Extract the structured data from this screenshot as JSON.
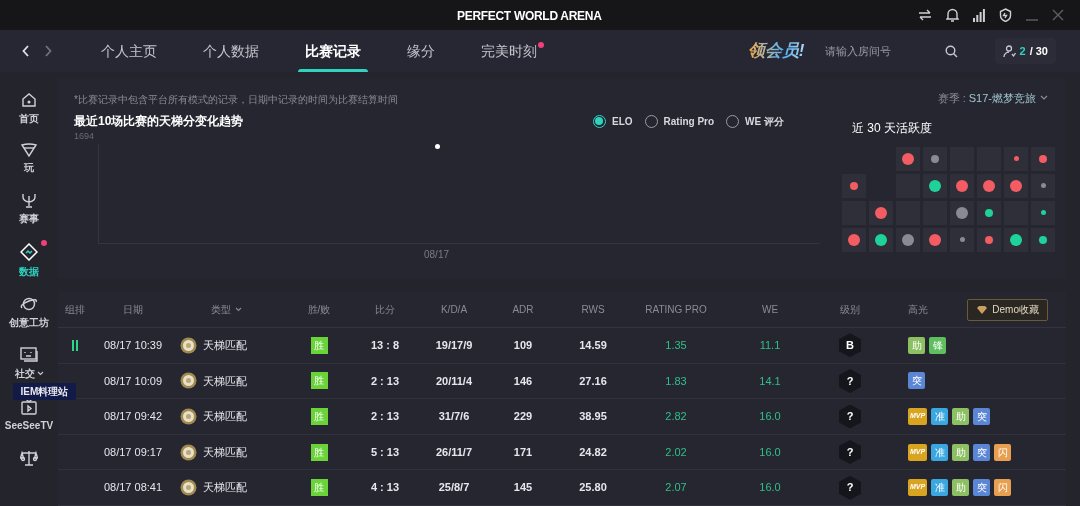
{
  "window": {
    "title": "PERFECT WORLD ARENA"
  },
  "nav_tabs": [
    {
      "label": "个人主页",
      "selected": false,
      "badge": false
    },
    {
      "label": "个人数据",
      "selected": false,
      "badge": false
    },
    {
      "label": "比赛记录",
      "selected": true,
      "badge": false
    },
    {
      "label": "缘分",
      "selected": false,
      "badge": false
    },
    {
      "label": "完美时刻",
      "selected": false,
      "badge": true
    }
  ],
  "promo": "领会员!",
  "search": {
    "placeholder": "请输入房间号"
  },
  "party_count": {
    "current": "2",
    "total": "/ 30"
  },
  "sidebar": {
    "items": [
      {
        "kind": "home",
        "label": "首页",
        "selected": false,
        "badge": false
      },
      {
        "kind": "play",
        "label": "玩",
        "selected": false,
        "badge": false
      },
      {
        "kind": "trophy",
        "label": "赛事",
        "selected": false,
        "badge": false
      },
      {
        "kind": "data",
        "label": "数据",
        "selected": true,
        "badge": true
      },
      {
        "kind": "planet",
        "label": "创意工坊",
        "selected": false,
        "badge": false
      },
      {
        "kind": "social",
        "label": "社交",
        "selected": false,
        "badge": false
      },
      {
        "kind": "tv",
        "label": "SeeSeeTV",
        "selected": false,
        "badge": false
      },
      {
        "kind": "scale",
        "selected": false,
        "badge": false
      }
    ],
    "tag": "IEM料理站"
  },
  "note": "*比赛记录中包含平台所有模式的记录，日期中记录的时间为比赛结算时间",
  "chart": {
    "title": "最近10场比赛的天梯分变化趋势",
    "y_label": "1694",
    "x_label": "08/17"
  },
  "metrics": [
    {
      "label": "ELO",
      "selected": true
    },
    {
      "label": "Rating Pro",
      "selected": false
    },
    {
      "label": "WE 评分",
      "selected": false
    }
  ],
  "season": {
    "label": "赛季 : ",
    "value": "S17-燃梦竞旅"
  },
  "activity": {
    "title": "近 30 天活跃度",
    "cells": [
      {
        "kind": "blank"
      },
      {
        "kind": "blank"
      },
      {
        "kind": "large",
        "color": "#f25c62"
      },
      {
        "kind": "small",
        "color": "#8a8a92"
      },
      {
        "kind": "empty"
      },
      {
        "kind": "empty"
      },
      {
        "kind": "tiny",
        "color": "#f25c62"
      },
      {
        "kind": "small",
        "color": "#f25c62"
      },
      {
        "kind": "small",
        "color": "#f25c62"
      },
      {
        "kind": "blank"
      },
      {
        "kind": "empty"
      },
      {
        "kind": "large",
        "color": "#1ed39a"
      },
      {
        "kind": "large",
        "color": "#f25c62"
      },
      {
        "kind": "large",
        "color": "#f25c62"
      },
      {
        "kind": "large",
        "color": "#f25c62"
      },
      {
        "kind": "tiny",
        "color": "#8a8a92"
      },
      {
        "kind": "empty"
      },
      {
        "kind": "large",
        "color": "#f25c62"
      },
      {
        "kind": "empty"
      },
      {
        "kind": "empty"
      },
      {
        "kind": "large",
        "color": "#8a8a92"
      },
      {
        "kind": "small",
        "color": "#1ed39a"
      },
      {
        "kind": "empty"
      },
      {
        "kind": "tiny",
        "color": "#1ed39a"
      },
      {
        "kind": "large",
        "color": "#f25c62"
      },
      {
        "kind": "large",
        "color": "#1ed39a"
      },
      {
        "kind": "large",
        "color": "#8a8a92"
      },
      {
        "kind": "large",
        "color": "#f25c62"
      },
      {
        "kind": "tiny",
        "color": "#8a8a92"
      },
      {
        "kind": "small",
        "color": "#f25c62"
      },
      {
        "kind": "large",
        "color": "#1ed39a"
      },
      {
        "kind": "small",
        "color": "#1ed39a"
      }
    ]
  },
  "table": {
    "columns": [
      "组排",
      "日期",
      "类型",
      "胜/败",
      "比分",
      "K/D/A",
      "ADR",
      "RWS",
      "RATING PRO",
      "WE",
      "级别",
      "高光"
    ],
    "demo_button": "Demo收藏",
    "rows": [
      {
        "party": true,
        "date": "08/17 10:39",
        "type": "天梯匹配",
        "result": "胜",
        "score": "13 : 8",
        "kda": "19/17/9",
        "adr": "109",
        "rws": "14.59",
        "rating": "1.35",
        "we": "11.1",
        "rank": "B",
        "highlights": [
          {
            "label": "助",
            "color": "#8cc063"
          },
          {
            "label": "锋",
            "color": "#5fbf5f"
          }
        ]
      },
      {
        "party": false,
        "date": "08/17 10:09",
        "type": "天梯匹配",
        "result": "胜",
        "score": "2 : 13",
        "kda": "20/11/4",
        "adr": "146",
        "rws": "27.16",
        "rating": "1.83",
        "we": "14.1",
        "rank": "?",
        "highlights": [
          {
            "label": "突",
            "color": "#5b86d6"
          }
        ]
      },
      {
        "party": false,
        "date": "08/17 09:42",
        "type": "天梯匹配",
        "result": "胜",
        "score": "2 : 13",
        "kda": "31/7/6",
        "adr": "229",
        "rws": "38.95",
        "rating": "2.82",
        "we": "16.0",
        "rank": "?",
        "highlights": [
          {
            "label": "MVP",
            "color": "#d9a520"
          },
          {
            "label": "准",
            "color": "#3aa7e0"
          },
          {
            "label": "助",
            "color": "#8cc063"
          },
          {
            "label": "突",
            "color": "#5b86d6"
          }
        ]
      },
      {
        "party": false,
        "date": "08/17 09:17",
        "type": "天梯匹配",
        "result": "胜",
        "score": "5 : 13",
        "kda": "26/11/7",
        "adr": "171",
        "rws": "24.82",
        "rating": "2.02",
        "we": "16.0",
        "rank": "?",
        "highlights": [
          {
            "label": "MVP",
            "color": "#d9a520"
          },
          {
            "label": "准",
            "color": "#3aa7e0"
          },
          {
            "label": "助",
            "color": "#8cc063"
          },
          {
            "label": "突",
            "color": "#5b86d6"
          },
          {
            "label": "闪",
            "color": "#e8a050"
          }
        ]
      },
      {
        "party": false,
        "date": "08/17 08:41",
        "type": "天梯匹配",
        "result": "胜",
        "score": "4 : 13",
        "kda": "25/8/7",
        "adr": "145",
        "rws": "25.80",
        "rating": "2.07",
        "we": "16.0",
        "rank": "?",
        "highlights": [
          {
            "label": "MVP",
            "color": "#d9a520"
          },
          {
            "label": "准",
            "color": "#3aa7e0"
          },
          {
            "label": "助",
            "color": "#8cc063"
          },
          {
            "label": "突",
            "color": "#5b86d6"
          },
          {
            "label": "闪",
            "color": "#e8a050"
          }
        ]
      }
    ]
  }
}
